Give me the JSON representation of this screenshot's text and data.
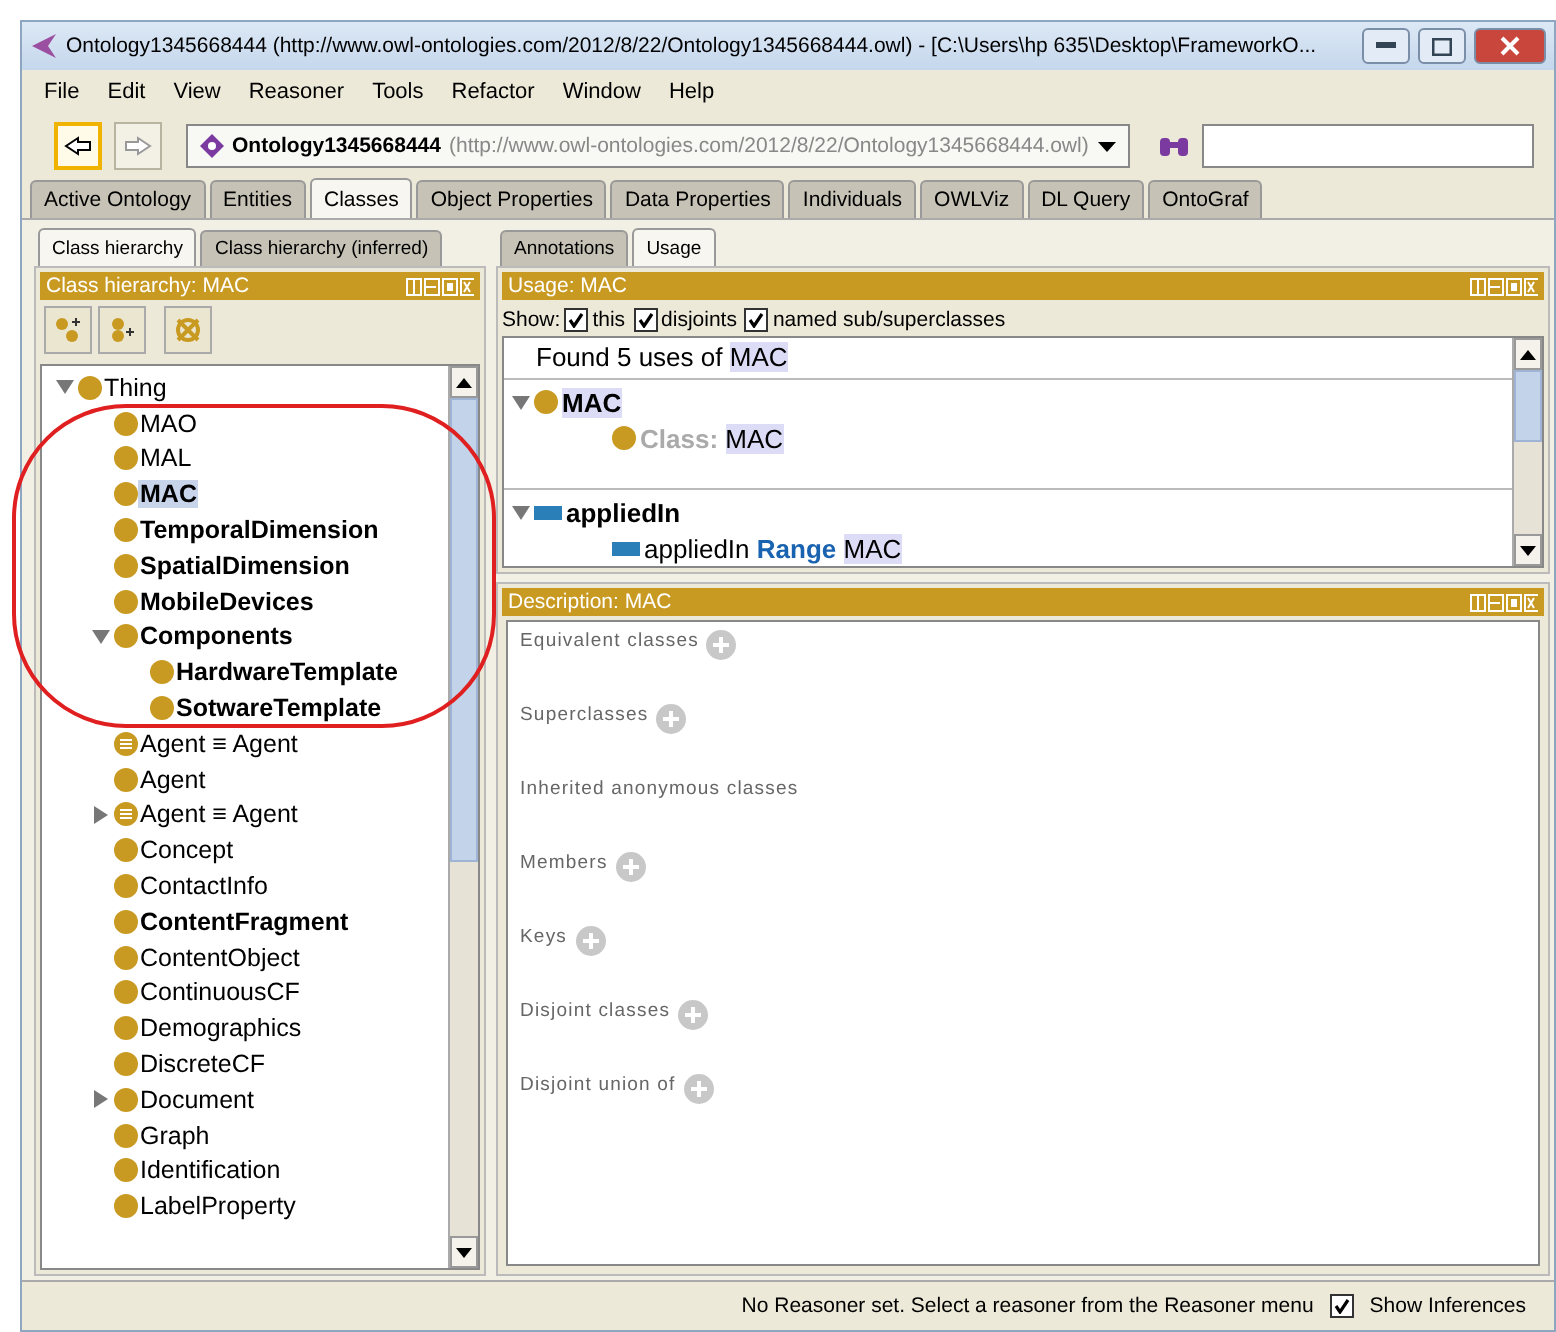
{
  "window": {
    "title": "Ontology1345668444 (http://www.owl-ontologies.com/2012/8/22/Ontology1345668444.owl) - [C:\\Users\\hp 635\\Desktop\\FrameworkO..."
  },
  "menu": [
    "File",
    "Edit",
    "View",
    "Reasoner",
    "Tools",
    "Refactor",
    "Window",
    "Help"
  ],
  "toolbar": {
    "ontology_name": "Ontology1345668444",
    "ontology_iri": "(http://www.owl-ontologies.com/2012/8/22/Ontology1345668444.owl)",
    "back_active": true
  },
  "tabs": [
    {
      "label": "Active Ontology",
      "selected": false
    },
    {
      "label": "Entities",
      "selected": false
    },
    {
      "label": "Classes",
      "selected": true
    },
    {
      "label": "Object Properties",
      "selected": false
    },
    {
      "label": "Data Properties",
      "selected": false
    },
    {
      "label": "Individuals",
      "selected": false
    },
    {
      "label": "OWLViz",
      "selected": false
    },
    {
      "label": "DL Query",
      "selected": false
    },
    {
      "label": "OntoGraf",
      "selected": false
    }
  ],
  "left": {
    "tabs": [
      {
        "label": "Class hierarchy",
        "selected": true
      },
      {
        "label": "Class hierarchy (inferred)",
        "selected": false
      }
    ],
    "panel_title": "Class hierarchy: MAC",
    "tree": [
      {
        "label": "Thing",
        "kind": "class",
        "bold": false,
        "selected": false,
        "expandable": true,
        "expanded": true,
        "children": [
          {
            "label": "MAO",
            "kind": "class",
            "bold": false,
            "selected": false,
            "expandable": false
          },
          {
            "label": "MAL",
            "kind": "class",
            "bold": false,
            "selected": false,
            "expandable": false
          },
          {
            "label": "MAC",
            "kind": "class",
            "bold": true,
            "selected": true,
            "expandable": false
          },
          {
            "label": "TemporalDimension",
            "kind": "class",
            "bold": true,
            "selected": false,
            "expandable": false
          },
          {
            "label": "SpatialDimension",
            "kind": "class",
            "bold": true,
            "selected": false,
            "expandable": false
          },
          {
            "label": "MobileDevices",
            "kind": "class",
            "bold": true,
            "selected": false,
            "expandable": false
          },
          {
            "label": "Components",
            "kind": "class",
            "bold": true,
            "selected": false,
            "expandable": true,
            "expanded": true,
            "children": [
              {
                "label": "HardwareTemplate",
                "kind": "class",
                "bold": true,
                "selected": false,
                "expandable": false
              },
              {
                "label": "SotwareTemplate",
                "kind": "class",
                "bold": true,
                "selected": false,
                "expandable": false
              }
            ]
          },
          {
            "label": "Agent ≡ Agent",
            "kind": "defined",
            "bold": false,
            "selected": false,
            "expandable": false
          },
          {
            "label": "Agent",
            "kind": "class",
            "bold": false,
            "selected": false,
            "expandable": false
          },
          {
            "label": "Agent ≡ Agent",
            "kind": "defined",
            "bold": false,
            "selected": false,
            "expandable": true,
            "expanded": false
          },
          {
            "label": "Concept",
            "kind": "class",
            "bold": false,
            "selected": false,
            "expandable": false
          },
          {
            "label": "ContactInfo",
            "kind": "class",
            "bold": false,
            "selected": false,
            "expandable": false
          },
          {
            "label": "ContentFragment",
            "kind": "class",
            "bold": true,
            "selected": false,
            "expandable": false
          },
          {
            "label": "ContentObject",
            "kind": "class",
            "bold": false,
            "selected": false,
            "expandable": false
          },
          {
            "label": "ContinuousCF",
            "kind": "class",
            "bold": false,
            "selected": false,
            "expandable": false
          },
          {
            "label": "Demographics",
            "kind": "class",
            "bold": false,
            "selected": false,
            "expandable": false
          },
          {
            "label": "DiscreteCF",
            "kind": "class",
            "bold": false,
            "selected": false,
            "expandable": false
          },
          {
            "label": "Document",
            "kind": "class",
            "bold": false,
            "selected": false,
            "expandable": true,
            "expanded": false
          },
          {
            "label": "Graph",
            "kind": "class",
            "bold": false,
            "selected": false,
            "expandable": false
          },
          {
            "label": "Identification",
            "kind": "class",
            "bold": false,
            "selected": false,
            "expandable": false
          },
          {
            "label": "LabelProperty",
            "kind": "class",
            "bold": false,
            "selected": false,
            "expandable": false
          }
        ]
      }
    ]
  },
  "right": {
    "tabs": [
      {
        "label": "Annotations",
        "selected": false
      },
      {
        "label": "Usage",
        "selected": true
      }
    ],
    "usage_title": "Usage: MAC",
    "show_label": "Show:",
    "show_options": [
      {
        "label": "this",
        "checked": true
      },
      {
        "label": "disjoints",
        "checked": true
      },
      {
        "label": "named sub/superclasses",
        "checked": true
      }
    ],
    "found_text": "Found 5 uses of",
    "found_target": "MAC",
    "usage_groups": [
      {
        "kind": "class",
        "label": "MAC",
        "entries": [
          {
            "kind": "class",
            "keyword": "Class:",
            "target": "MAC"
          }
        ]
      },
      {
        "kind": "property",
        "label": "appliedIn",
        "entries": [
          {
            "kind": "property",
            "subject": "appliedIn",
            "keyword": "Range",
            "target": "MAC"
          }
        ]
      }
    ],
    "description_title": "Description: MAC",
    "sections": [
      {
        "label": "Equivalent classes",
        "addable": true
      },
      {
        "label": "Superclasses",
        "addable": true
      },
      {
        "label": "Inherited anonymous classes",
        "addable": false
      },
      {
        "label": "Members",
        "addable": true
      },
      {
        "label": "Keys",
        "addable": true
      },
      {
        "label": "Disjoint classes",
        "addable": true
      },
      {
        "label": "Disjoint union of",
        "addable": true
      }
    ]
  },
  "status_bar": {
    "message": "No Reasoner set. Select a reasoner from the Reasoner menu",
    "show_inferences": {
      "label": "Show Inferences",
      "checked": true
    }
  }
}
